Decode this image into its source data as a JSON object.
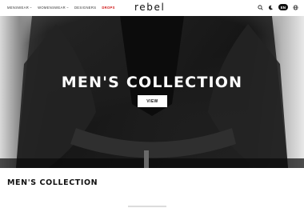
{
  "header": {
    "nav": [
      {
        "label": "MENSWEAR",
        "has_dropdown": true
      },
      {
        "label": "WOMENSWEAR",
        "has_dropdown": true
      },
      {
        "label": "DESIGNERS",
        "has_dropdown": false
      },
      {
        "label": "DROPS",
        "has_dropdown": false
      }
    ],
    "logo": "rebel",
    "icons": [
      "search-icon",
      "moon-icon",
      "globe-icon"
    ],
    "language": "EN"
  },
  "hero": {
    "title": "MEN'S COLLECTION",
    "button_label": "VIEW"
  },
  "section": {
    "title": "MEN'S COLLECTION"
  },
  "colors": {
    "drops_accent": "#d01818",
    "hero_text": "#ffffff",
    "badge_bg": "#111111"
  }
}
